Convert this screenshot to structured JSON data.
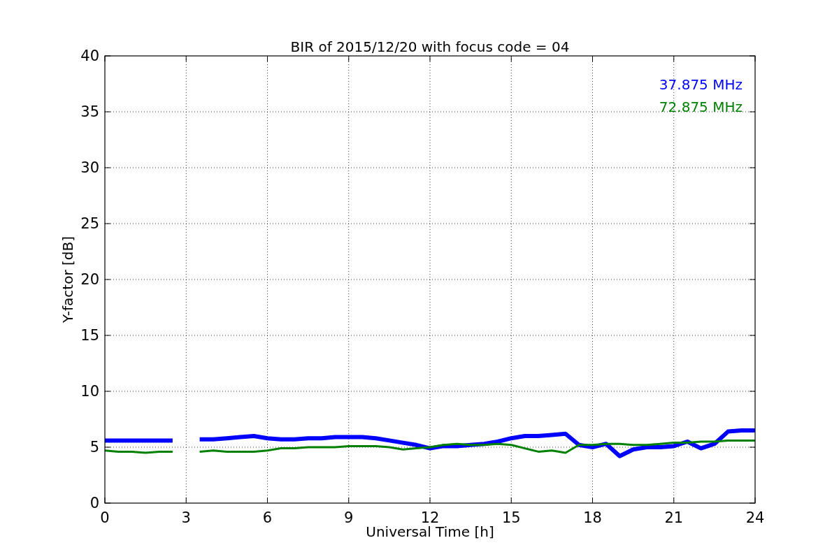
{
  "figure": {
    "chart_data": {
      "type": "line",
      "title": "BIR of 2015/12/20 with focus code = 04",
      "xlabel": "Universal Time [h]",
      "ylabel": "Y-factor [dB]",
      "x": [
        0,
        0.5,
        1,
        1.5,
        2,
        2.5,
        3,
        3.5,
        4,
        4.5,
        5,
        5.5,
        6,
        6.5,
        7,
        7.5,
        8,
        8.5,
        9,
        9.5,
        10,
        10.5,
        11,
        11.5,
        12,
        12.5,
        13,
        13.5,
        14,
        14.5,
        15,
        15.5,
        16,
        16.5,
        17,
        17.5,
        18,
        18.5,
        19,
        19.5,
        20,
        20.5,
        21,
        21.5,
        22,
        22.5,
        23,
        23.5,
        24
      ],
      "series": [
        {
          "name": "37.875 MHz",
          "color": "#0000ff",
          "values": [
            5.6,
            5.6,
            5.6,
            5.6,
            5.6,
            5.6,
            null,
            5.7,
            5.7,
            5.8,
            5.9,
            6.0,
            5.8,
            5.7,
            5.7,
            5.8,
            5.8,
            5.9,
            5.9,
            5.9,
            5.8,
            5.6,
            5.4,
            5.2,
            4.9,
            5.1,
            5.1,
            5.2,
            5.3,
            5.5,
            5.8,
            6.0,
            6.0,
            6.1,
            6.2,
            5.2,
            5.0,
            5.3,
            4.2,
            4.8,
            5.0,
            5.0,
            5.1,
            5.5,
            4.9,
            5.3,
            6.4,
            6.5,
            6.5
          ]
        },
        {
          "name": "72.875 MHz",
          "color": "#008000",
          "values": [
            4.7,
            4.6,
            4.6,
            4.5,
            4.6,
            4.6,
            null,
            4.6,
            4.7,
            4.6,
            4.6,
            4.6,
            4.7,
            4.9,
            4.9,
            5.0,
            5.0,
            5.0,
            5.1,
            5.1,
            5.1,
            5.0,
            4.8,
            4.9,
            5.0,
            5.2,
            5.3,
            5.2,
            5.2,
            5.3,
            5.2,
            4.9,
            4.6,
            4.7,
            4.5,
            5.2,
            5.2,
            5.3,
            5.3,
            5.2,
            5.2,
            5.3,
            5.4,
            5.4,
            5.5,
            5.5,
            5.6,
            5.6,
            5.6
          ]
        }
      ],
      "grid": true,
      "xlim": [
        0,
        24
      ],
      "ylim": [
        0,
        40
      ],
      "xticks": [
        0,
        3,
        6,
        9,
        12,
        15,
        18,
        21,
        24
      ],
      "yticks": [
        0,
        5,
        10,
        15,
        20,
        25,
        30,
        35,
        40
      ]
    }
  }
}
